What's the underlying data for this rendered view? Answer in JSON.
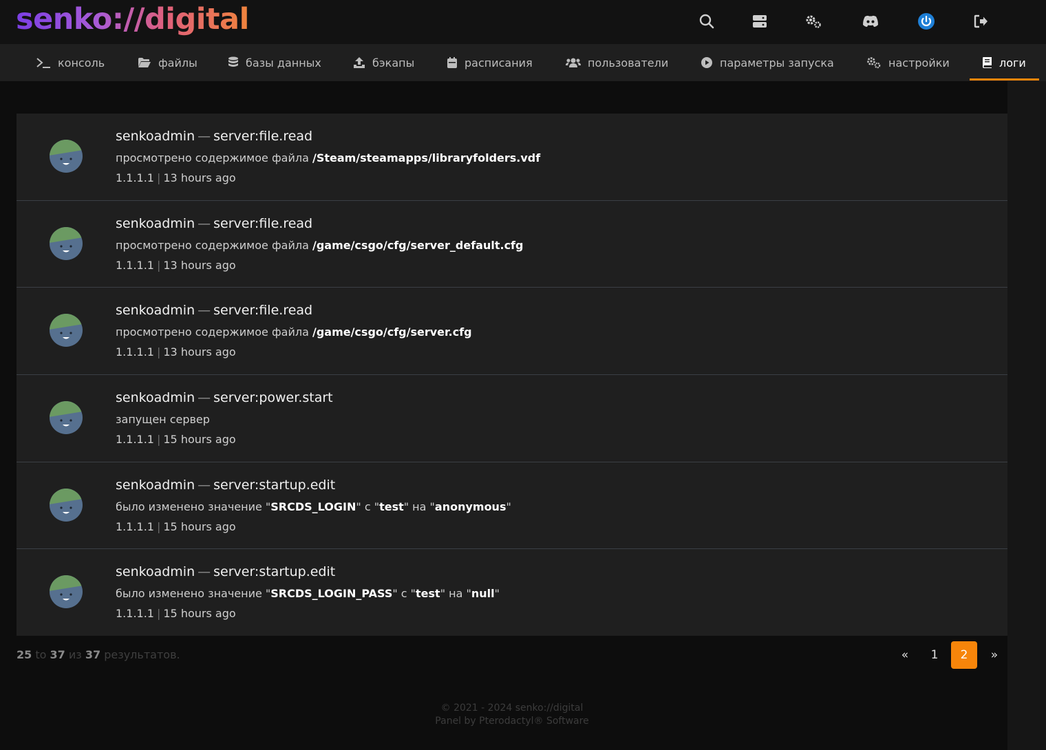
{
  "header": {
    "logo": "senko://digital",
    "icons": [
      "search-icon",
      "servers-icon",
      "admin-gears-icon",
      "discord-icon",
      "power-icon",
      "logout-icon"
    ]
  },
  "nav": {
    "tabs": [
      {
        "label": "консоль",
        "icon": "terminal-icon"
      },
      {
        "label": "файлы",
        "icon": "folder-icon"
      },
      {
        "label": "базы данных",
        "icon": "database-icon"
      },
      {
        "label": "бэкапы",
        "icon": "upload-icon"
      },
      {
        "label": "расписания",
        "icon": "calendar-icon"
      },
      {
        "label": "пользователи",
        "icon": "users-icon"
      },
      {
        "label": "параметры запуска",
        "icon": "play-circle-icon"
      },
      {
        "label": "настройки",
        "icon": "gears-icon"
      },
      {
        "label": "логи",
        "icon": "book-icon",
        "active": true
      }
    ]
  },
  "logs": [
    {
      "user": "senkoadmin",
      "dash": "—",
      "event": "server:file.read",
      "desc_prefix": "просмотрено содержимое файла ",
      "desc_strong": "/Steam/steamapps/libraryfolders.vdf",
      "ip": "1.1.1.1",
      "sep": "|",
      "time": "13 hours ago"
    },
    {
      "user": "senkoadmin",
      "dash": "—",
      "event": "server:file.read",
      "desc_prefix": "просмотрено содержимое файла ",
      "desc_strong": "/game/csgo/cfg/server_default.cfg",
      "ip": "1.1.1.1",
      "sep": "|",
      "time": "13 hours ago"
    },
    {
      "user": "senkoadmin",
      "dash": "—",
      "event": "server:file.read",
      "desc_prefix": "просмотрено содержимое файла ",
      "desc_strong": "/game/csgo/cfg/server.cfg",
      "ip": "1.1.1.1",
      "sep": "|",
      "time": "13 hours ago"
    },
    {
      "user": "senkoadmin",
      "dash": "—",
      "event": "server:power.start",
      "desc_prefix": "запущен сервер",
      "desc_strong": "",
      "ip": "1.1.1.1",
      "sep": "|",
      "time": "15 hours ago"
    },
    {
      "user": "senkoadmin",
      "dash": "—",
      "event": "server:startup.edit",
      "desc_parts": [
        "было изменено значение \"",
        "SRCDS_LOGIN",
        "\" с \"",
        "test",
        "\" на \"",
        "anonymous",
        "\""
      ],
      "ip": "1.1.1.1",
      "sep": "|",
      "time": "15 hours ago"
    },
    {
      "user": "senkoadmin",
      "dash": "—",
      "event": "server:startup.edit",
      "desc_parts": [
        "было изменено значение \"",
        "SRCDS_LOGIN_PASS",
        "\" с \"",
        "test",
        "\" на \"",
        "null",
        "\""
      ],
      "ip": "1.1.1.1",
      "sep": "|",
      "time": "15 hours ago"
    }
  ],
  "pagination": {
    "from": "25",
    "to_word": " to ",
    "to": "37",
    "of_word": " из ",
    "total": "37",
    "suffix": " результатов.",
    "prev": "«",
    "pages": [
      "1",
      "2"
    ],
    "current": "2",
    "next": "»"
  },
  "footer": {
    "line1": "© 2021 - 2024 senko://digital",
    "line2": "Panel by Pterodactyl® Software"
  },
  "colors": {
    "accent": "#f7850a",
    "background": "#0d0d0d",
    "card": "#1f1f1f"
  }
}
